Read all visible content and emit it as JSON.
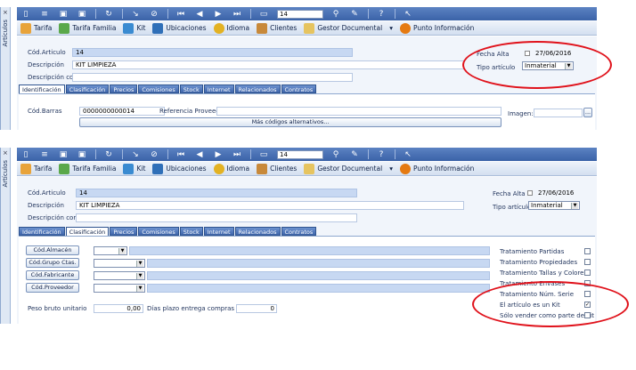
{
  "app": {
    "side_label": "Artículos",
    "close_glyph": "×"
  },
  "toolbar": {
    "record_number": "14"
  },
  "modules": [
    {
      "label": "Tarifa"
    },
    {
      "label": "Tarifa Familia"
    },
    {
      "label": "Kit"
    },
    {
      "label": "Ubicaciones"
    },
    {
      "label": "Idioma"
    },
    {
      "label": "Clientes"
    },
    {
      "label": "Gestor Documental"
    },
    {
      "label": "Punto Información"
    }
  ],
  "header": {
    "cod_articulo_label": "Cód.Articulo",
    "cod_articulo_value": "14",
    "descripcion_label": "Descripción",
    "descripcion_value": "KIT LIMPIEZA",
    "descripcion_corta_label": "Descripción corta",
    "fecha_alta_label": "Fecha Alta",
    "fecha_alta_value": "27/06/2016",
    "tipo_articulo_label": "Tipo artículo",
    "tipo_articulo_value": "Inmaterial"
  },
  "tabs": [
    "Identificación",
    "Clasificación",
    "Precios",
    "Comisiones",
    "Stock",
    "Internet",
    "Relacionados",
    "Contratos"
  ],
  "identificacion": {
    "cod_barras_label": "Cód.Barras",
    "cod_barras_value": "0000000000014",
    "ref_proveedor_label": "Referencia Proveedor",
    "mas_codigos_label": "Más códigos alternativos...",
    "imagen_label": "Imagen:",
    "imagen_button": "..."
  },
  "clasificacion": {
    "buttons": [
      "Cód.Almacén",
      "Cód.Grupo Ctas.",
      "Cód.Fabricante",
      "Cód.Proveedor"
    ],
    "bottom_label_1": "Peso bruto unitario",
    "bottom_value_1": "0,00",
    "bottom_label_2": "Días plazo entrega compras",
    "bottom_value_2": "0",
    "tratamientos": [
      {
        "label": "Tratamiento Partidas",
        "checked": false
      },
      {
        "label": "Tratamiento Propiedades",
        "checked": false
      },
      {
        "label": "Tratamiento Tallas y Colores",
        "checked": false
      },
      {
        "label": "Tratamiento Envases",
        "checked": false
      },
      {
        "label": "Tratamiento Núm. Serie",
        "checked": false
      },
      {
        "label": "El artículo es un Kit",
        "checked": true
      },
      {
        "label": "Sólo vender como parte de kit",
        "checked": false
      }
    ],
    "check_mark": "✓"
  },
  "colors": {
    "toolbar": "#3b63a8",
    "highlight": "#e0121b",
    "field_blue": "#c7d8f2"
  }
}
